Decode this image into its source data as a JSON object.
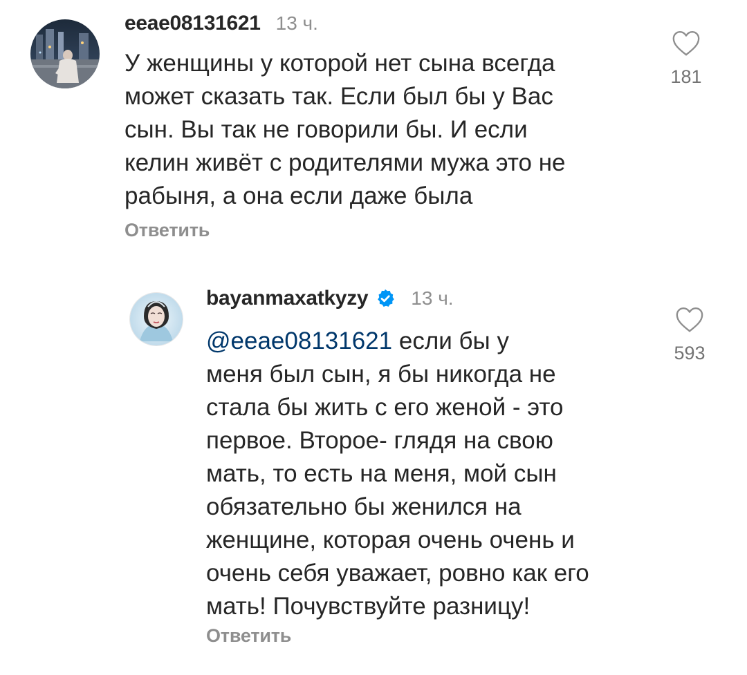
{
  "comments": [
    {
      "username": "eeae08131621",
      "time": "13 ч.",
      "text": "У женщины у которой нет сына всегда\nможет сказать так. Если был бы у Вас\nсын. Вы так не говорили бы. И если\nкелин живёт с родителями мужа это не\nрабыня, а она если даже была",
      "reply_label": "Ответить",
      "likes": "181",
      "avatar_icon": "avatar-photo-night-city"
    },
    {
      "username": "bayanmaxatkyzy",
      "verified": true,
      "time": "13 ч.",
      "mention": "@eeae08131621",
      "text_first": " если бы  у",
      "text": "меня был сын, я бы никогда не\nстала бы жить с его женой - это\nпервое. Второе- глядя на свою\nмать, то есть на меня,  мой сын\nобязательно бы женился на\nженщине, которая очень очень и\nочень себя уважает, ровно как его\nмать! Почувствуйте разницу!",
      "reply_label": "Ответить",
      "likes": "593",
      "avatar_icon": "avatar-photo-portrait"
    }
  ],
  "colors": {
    "text": "#262626",
    "secondary": "#8e8e8e",
    "mention": "#00376b",
    "verified": "#0095f6"
  }
}
